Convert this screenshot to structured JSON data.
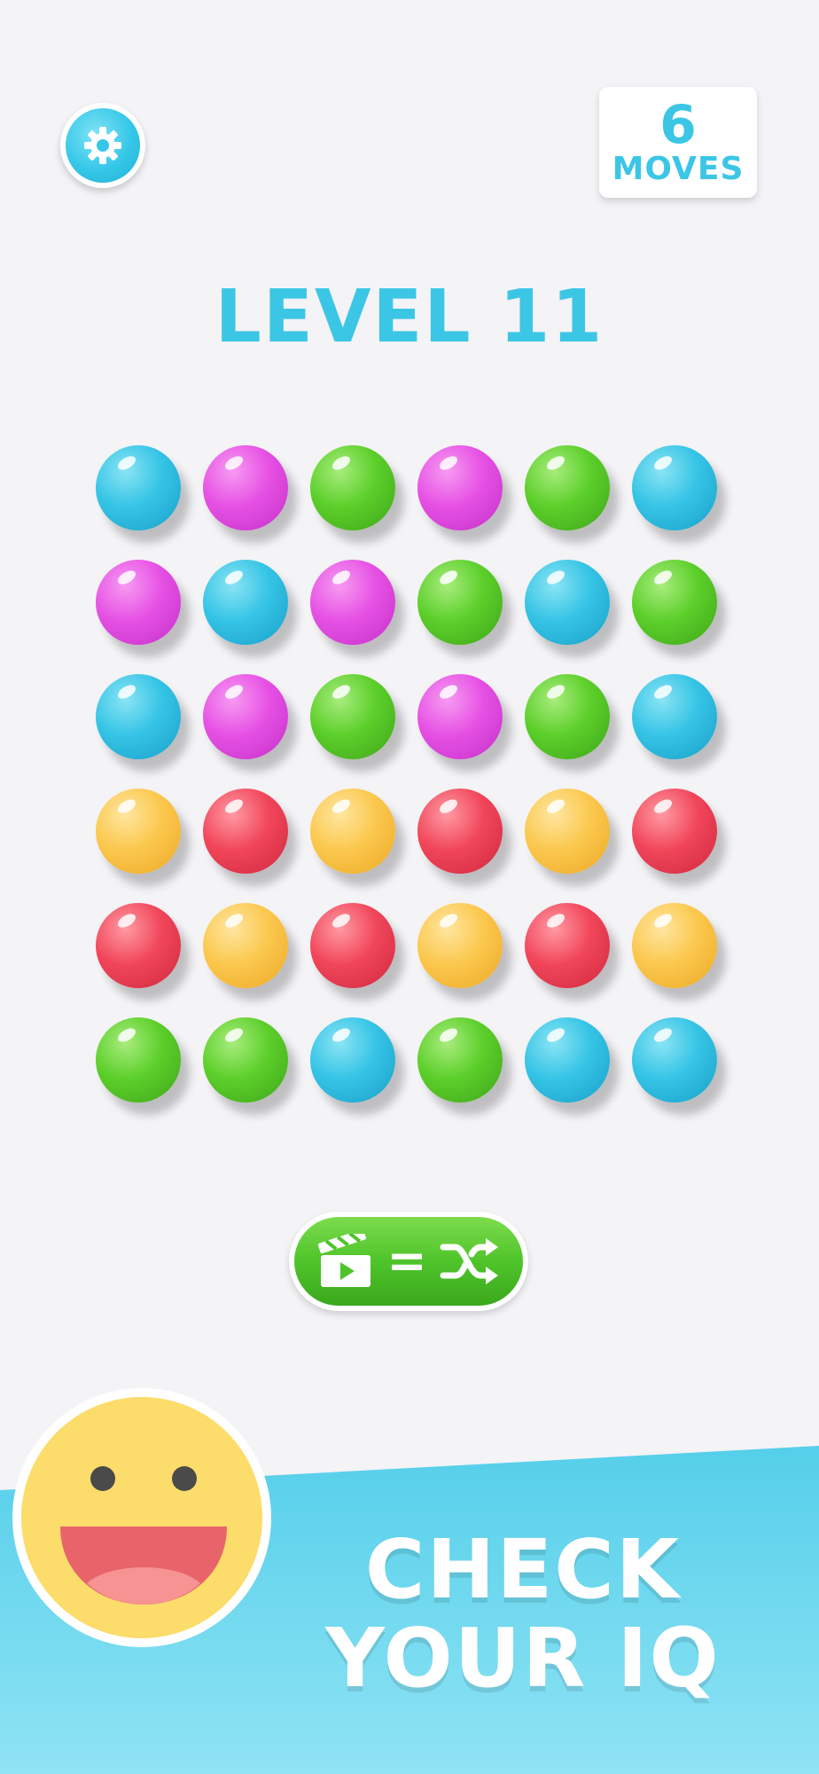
{
  "header": {
    "moves_count": "6",
    "moves_label": "MOVES",
    "level_title": "LEVEL 11"
  },
  "board": {
    "rows": [
      [
        "blue",
        "purple",
        "green",
        "purple",
        "green",
        "blue"
      ],
      [
        "purple",
        "blue",
        "purple",
        "green",
        "blue",
        "green"
      ],
      [
        "blue",
        "purple",
        "green",
        "purple",
        "green",
        "blue"
      ],
      [
        "yellow",
        "red",
        "yellow",
        "red",
        "yellow",
        "red"
      ],
      [
        "red",
        "yellow",
        "red",
        "yellow",
        "red",
        "yellow"
      ],
      [
        "green",
        "green",
        "blue",
        "green",
        "blue",
        "blue"
      ]
    ]
  },
  "shuffle_button": {
    "equals": "=",
    "icons": [
      "clapperboard-play-icon",
      "shuffle-icon"
    ]
  },
  "promo": {
    "line1": "CHECK",
    "line2": "YOUR IQ"
  },
  "colors": {
    "accent": "#3cc6e6",
    "background": "#f4f3f6",
    "button_green": "#4fc42a",
    "smiley_face": "#fcdc6a"
  }
}
